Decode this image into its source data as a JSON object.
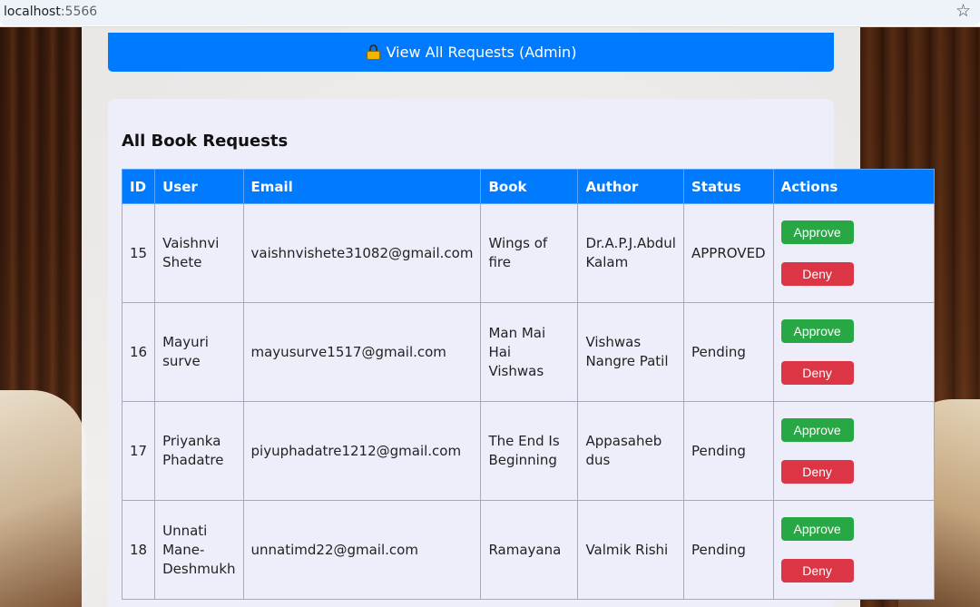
{
  "browser": {
    "url_host": "localhost",
    "url_port": ":5566",
    "star_icon": "★"
  },
  "admin_button": {
    "icon": "lock-icon",
    "label": "View All Requests (Admin)"
  },
  "panel": {
    "title": "All Book Requests"
  },
  "table": {
    "headers": [
      "ID",
      "User",
      "Email",
      "Book",
      "Author",
      "Status",
      "Actions"
    ],
    "rows": [
      {
        "id": "15",
        "user": "Vaishnvi Shete",
        "email": "vaishnvishete31082@gmail.com",
        "book": "Wings of fire",
        "author": "Dr.A.P.J.Abdul Kalam",
        "status": "APPROVED",
        "approve": "Approve",
        "deny": "Deny"
      },
      {
        "id": "16",
        "user": "Mayuri surve",
        "email": "mayusurve1517@gmail.com",
        "book": "Man Mai Hai Vishwas",
        "author": "Vishwas Nangre Patil",
        "status": "Pending",
        "approve": "Approve",
        "deny": "Deny"
      },
      {
        "id": "17",
        "user": "Priyanka Phadatre",
        "email": "piyuphadatre1212@gmail.com",
        "book": "The End Is Beginning",
        "author": "Appasaheb dus",
        "status": "Pending",
        "approve": "Approve",
        "deny": "Deny"
      },
      {
        "id": "18",
        "user": "Unnati Mane-Deshmukh",
        "email": "unnatimd22@gmail.com",
        "book": "Ramayana",
        "author": "Valmik Rishi",
        "status": "Pending",
        "approve": "Approve",
        "deny": "Deny"
      }
    ]
  },
  "colors": {
    "primary": "#007bff",
    "approve": "#28a745",
    "deny": "#dc3545",
    "panel_bg": "#eeeefa"
  }
}
